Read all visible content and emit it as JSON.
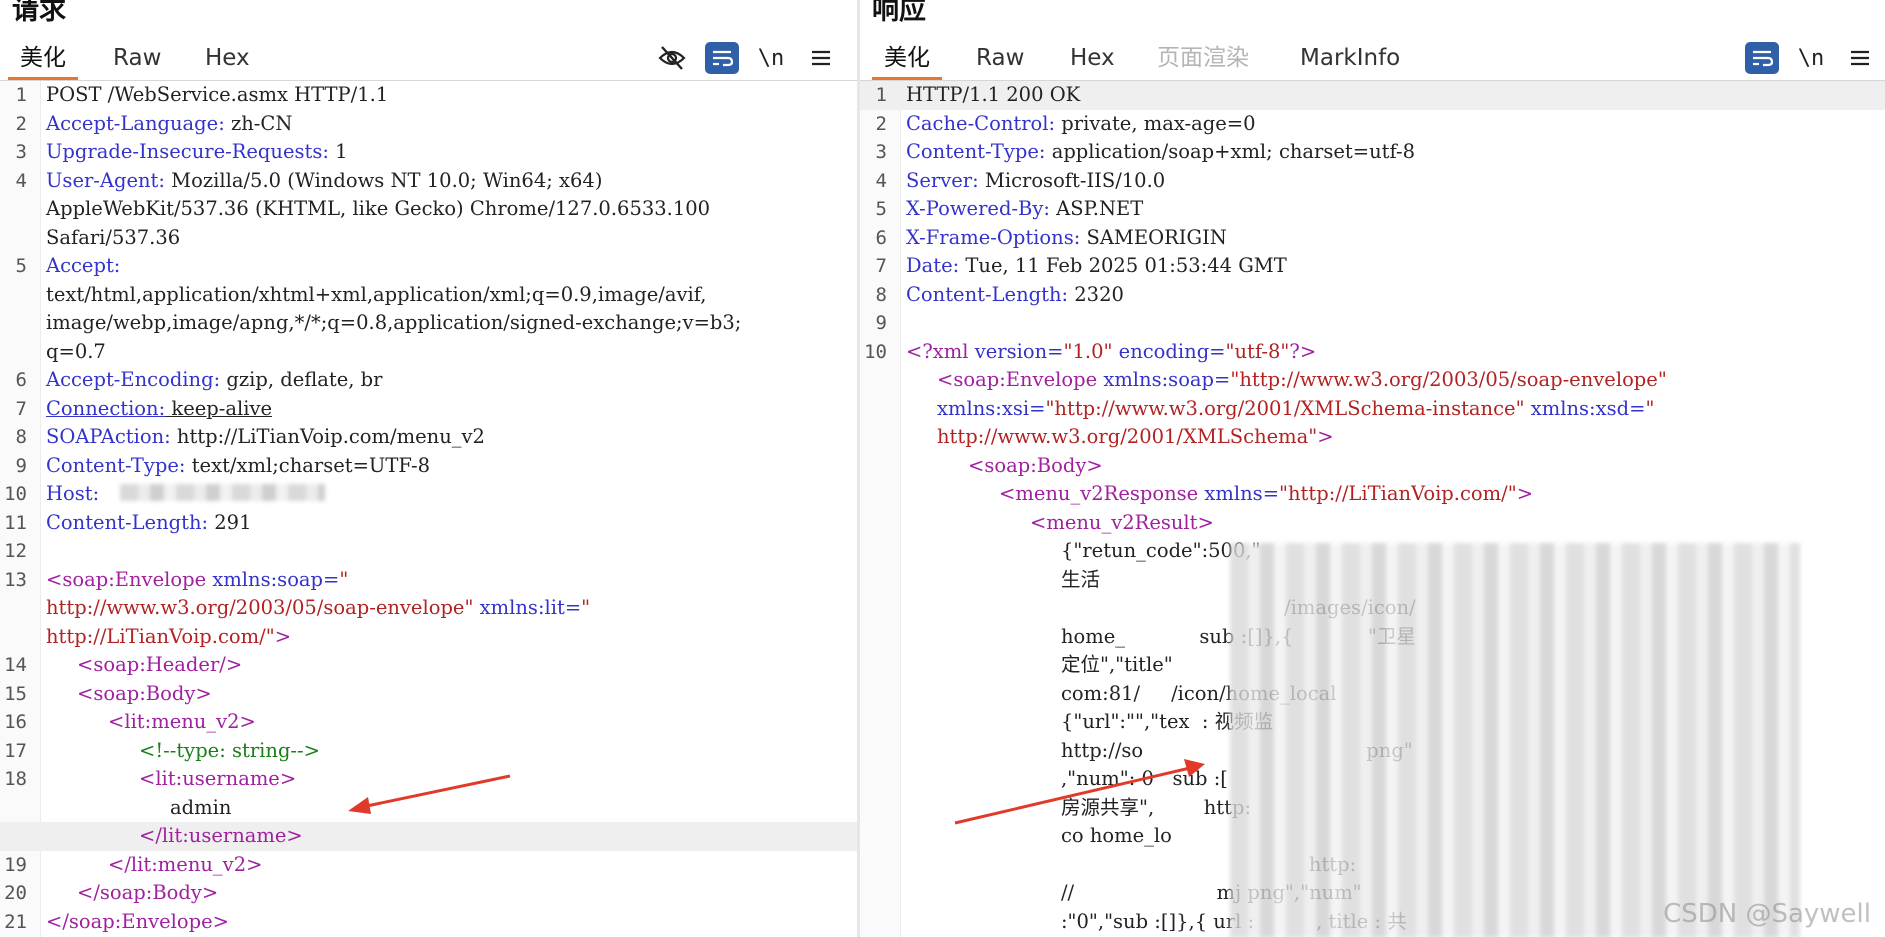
{
  "request": {
    "title": "请求",
    "tabs": [
      "美化",
      "Raw",
      "Hex"
    ],
    "icons": [
      "eye-off-icon",
      "wrap-icon",
      "newline-icon",
      "menu-icon"
    ],
    "newline_label": "\\n",
    "lines": [
      {
        "n": "1",
        "text": "POST /WebService.asmx HTTP/1.1"
      },
      {
        "n": "2",
        "key": "Accept-Language:",
        "val": " zh-CN"
      },
      {
        "n": "3",
        "key": "Upgrade-Insecure-Requests:",
        "val": " 1"
      },
      {
        "n": "4",
        "key": "User-Agent:",
        "val": " Mozilla/5.0 (Windows NT 10.0; Win64; x64)"
      },
      {
        "n": "",
        "text": "AppleWebKit/537.36 (KHTML, like Gecko) Chrome/127.0.6533.100"
      },
      {
        "n": "",
        "text": "Safari/537.36"
      },
      {
        "n": "5",
        "key": "Accept:",
        "val": ""
      },
      {
        "n": "",
        "text": "text/html,application/xhtml+xml,application/xml;q=0.9,image/avif,"
      },
      {
        "n": "",
        "text": "image/webp,image/apng,*/*;q=0.8,application/signed-exchange;v=b3;"
      },
      {
        "n": "",
        "text": "q=0.7"
      },
      {
        "n": "6",
        "key": "Accept-Encoding:",
        "val": " gzip, deflate, br"
      },
      {
        "n": "7",
        "key": "Connection:",
        "val": " keep-alive"
      },
      {
        "n": "8",
        "key": "SOAPAction:",
        "val": " http://LiTianVoip.com/menu_v2"
      },
      {
        "n": "9",
        "key": "Content-Type:",
        "val": " text/xml;charset=UTF-8"
      },
      {
        "n": "10",
        "key": "Host:",
        "val": ""
      },
      {
        "n": "11",
        "key": "Content-Length:",
        "val": " 291"
      },
      {
        "n": "12",
        "text": ""
      },
      {
        "n": "13",
        "tag": "<soap:Envelope",
        "attr": " xmlns:soap=",
        "str": "\""
      },
      {
        "n": "",
        "str": "http://www.w3.org/2003/05/soap-envelope\"",
        "attr": " xmlns:lit=",
        "str2": "\""
      },
      {
        "n": "",
        "str": "http://LiTianVoip.com/\"",
        "tag": ">"
      },
      {
        "n": "14",
        "indent": "     ",
        "tag": "<soap:Header/>"
      },
      {
        "n": "15",
        "indent": "     ",
        "tag": "<soap:Body>"
      },
      {
        "n": "16",
        "indent": "          ",
        "tag": "<lit:menu_v2>"
      },
      {
        "n": "17",
        "indent": "               ",
        "comment": "<!--type: string-->"
      },
      {
        "n": "18",
        "indent": "               ",
        "tag": "<lit:username>"
      },
      {
        "n": "",
        "indent": "                    ",
        "text": "admin"
      },
      {
        "n": "",
        "indent": "               ",
        "tag": "</lit:username>",
        "hl": true
      },
      {
        "n": "19",
        "indent": "          ",
        "tag": "</lit:menu_v2>"
      },
      {
        "n": "20",
        "indent": "     ",
        "tag": "</soap:Body>"
      },
      {
        "n": "21",
        "tag": "</soap:Envelope>"
      }
    ]
  },
  "response": {
    "title": "响应",
    "tabs": [
      "美化",
      "Raw",
      "Hex",
      "页面渲染",
      "MarkInfo"
    ],
    "icons": [
      "wrap-icon",
      "newline-icon",
      "menu-icon"
    ],
    "newline_label": "\\n",
    "lines": [
      {
        "n": "1",
        "text": "HTTP/1.1 200 OK",
        "hl": true
      },
      {
        "n": "2",
        "key": "Cache-Control:",
        "val": " private, max-age=0"
      },
      {
        "n": "3",
        "key": "Content-Type:",
        "val": " application/soap+xml; charset=utf-8"
      },
      {
        "n": "4",
        "key": "Server:",
        "val": " Microsoft-IIS/10.0"
      },
      {
        "n": "5",
        "key": "X-Powered-By:",
        "val": " ASP.NET"
      },
      {
        "n": "6",
        "key": "X-Frame-Options:",
        "val": " SAMEORIGIN"
      },
      {
        "n": "7",
        "key": "Date:",
        "val": " Tue, 11 Feb 2025 01:53:44 GMT"
      },
      {
        "n": "8",
        "key": "Content-Length:",
        "val": " 2320"
      },
      {
        "n": "9",
        "text": ""
      },
      {
        "n": "10",
        "tag": "<?xml",
        "attr": " version=",
        "str": "\"1.0\"",
        "attr2": " encoding=",
        "str2": "\"utf-8\"",
        "tag2": "?>"
      },
      {
        "n": "",
        "indent": "     ",
        "tag": "<soap:Envelope",
        "attr": " xmlns:soap=",
        "str": "\"http://www.w3.org/2003/05/soap-envelope\""
      },
      {
        "n": "",
        "indent": "     ",
        "attr": "xmlns:xsi=",
        "str": "\"http://www.w3.org/2001/XMLSchema-instance\"",
        "attr2": " xmlns:xsd=",
        "str2": "\""
      },
      {
        "n": "",
        "indent": "     ",
        "str": "http://www.w3.org/2001/XMLSchema\"",
        "tag": ">"
      },
      {
        "n": "",
        "indent": "          ",
        "tag": "<soap:Body>"
      },
      {
        "n": "",
        "indent": "               ",
        "tag": "<menu_v2Response",
        "attr": " xmlns=",
        "str": "\"http://LiTianVoip.com/\"",
        "tag2": ">"
      },
      {
        "n": "",
        "indent": "                    ",
        "tag": "<menu_v2Result>"
      },
      {
        "n": "",
        "indent": "                         ",
        "text": "{\"retun_code\":500,\""
      },
      {
        "n": "",
        "indent": "                         ",
        "text": "生活"
      },
      {
        "n": "",
        "indent": "                         ",
        "text": "                                    /images/icon/"
      },
      {
        "n": "",
        "indent": "                         ",
        "text": "home_            sub :[]},{            \"卫星"
      },
      {
        "n": "",
        "indent": "                         ",
        "text": "定位\",\"title\""
      },
      {
        "n": "",
        "indent": "                         ",
        "text": "com:81/     /icon/home_local"
      },
      {
        "n": "",
        "indent": "                         ",
        "text": "{\"url\":\"\",\"tex  : 视频监"
      },
      {
        "n": "",
        "indent": "                         ",
        "text": "http://so                                    png\""
      },
      {
        "n": "",
        "indent": "                         ",
        "text": ",\"num\": 0   sub :["
      },
      {
        "n": "",
        "indent": "                         ",
        "text": "房源共享\",        http:"
      },
      {
        "n": "",
        "indent": "                         ",
        "text": "co home_lo"
      },
      {
        "n": "",
        "indent": "                         ",
        "text": "                                        http:"
      },
      {
        "n": "",
        "indent": "                         ",
        "text": "//                       mj png\",\"num\""
      },
      {
        "n": "",
        "indent": "                         ",
        "text": ":\"0\",\"sub :[]},{ url :          , title : 共"
      }
    ]
  },
  "watermark": "CSDN @Saywell"
}
